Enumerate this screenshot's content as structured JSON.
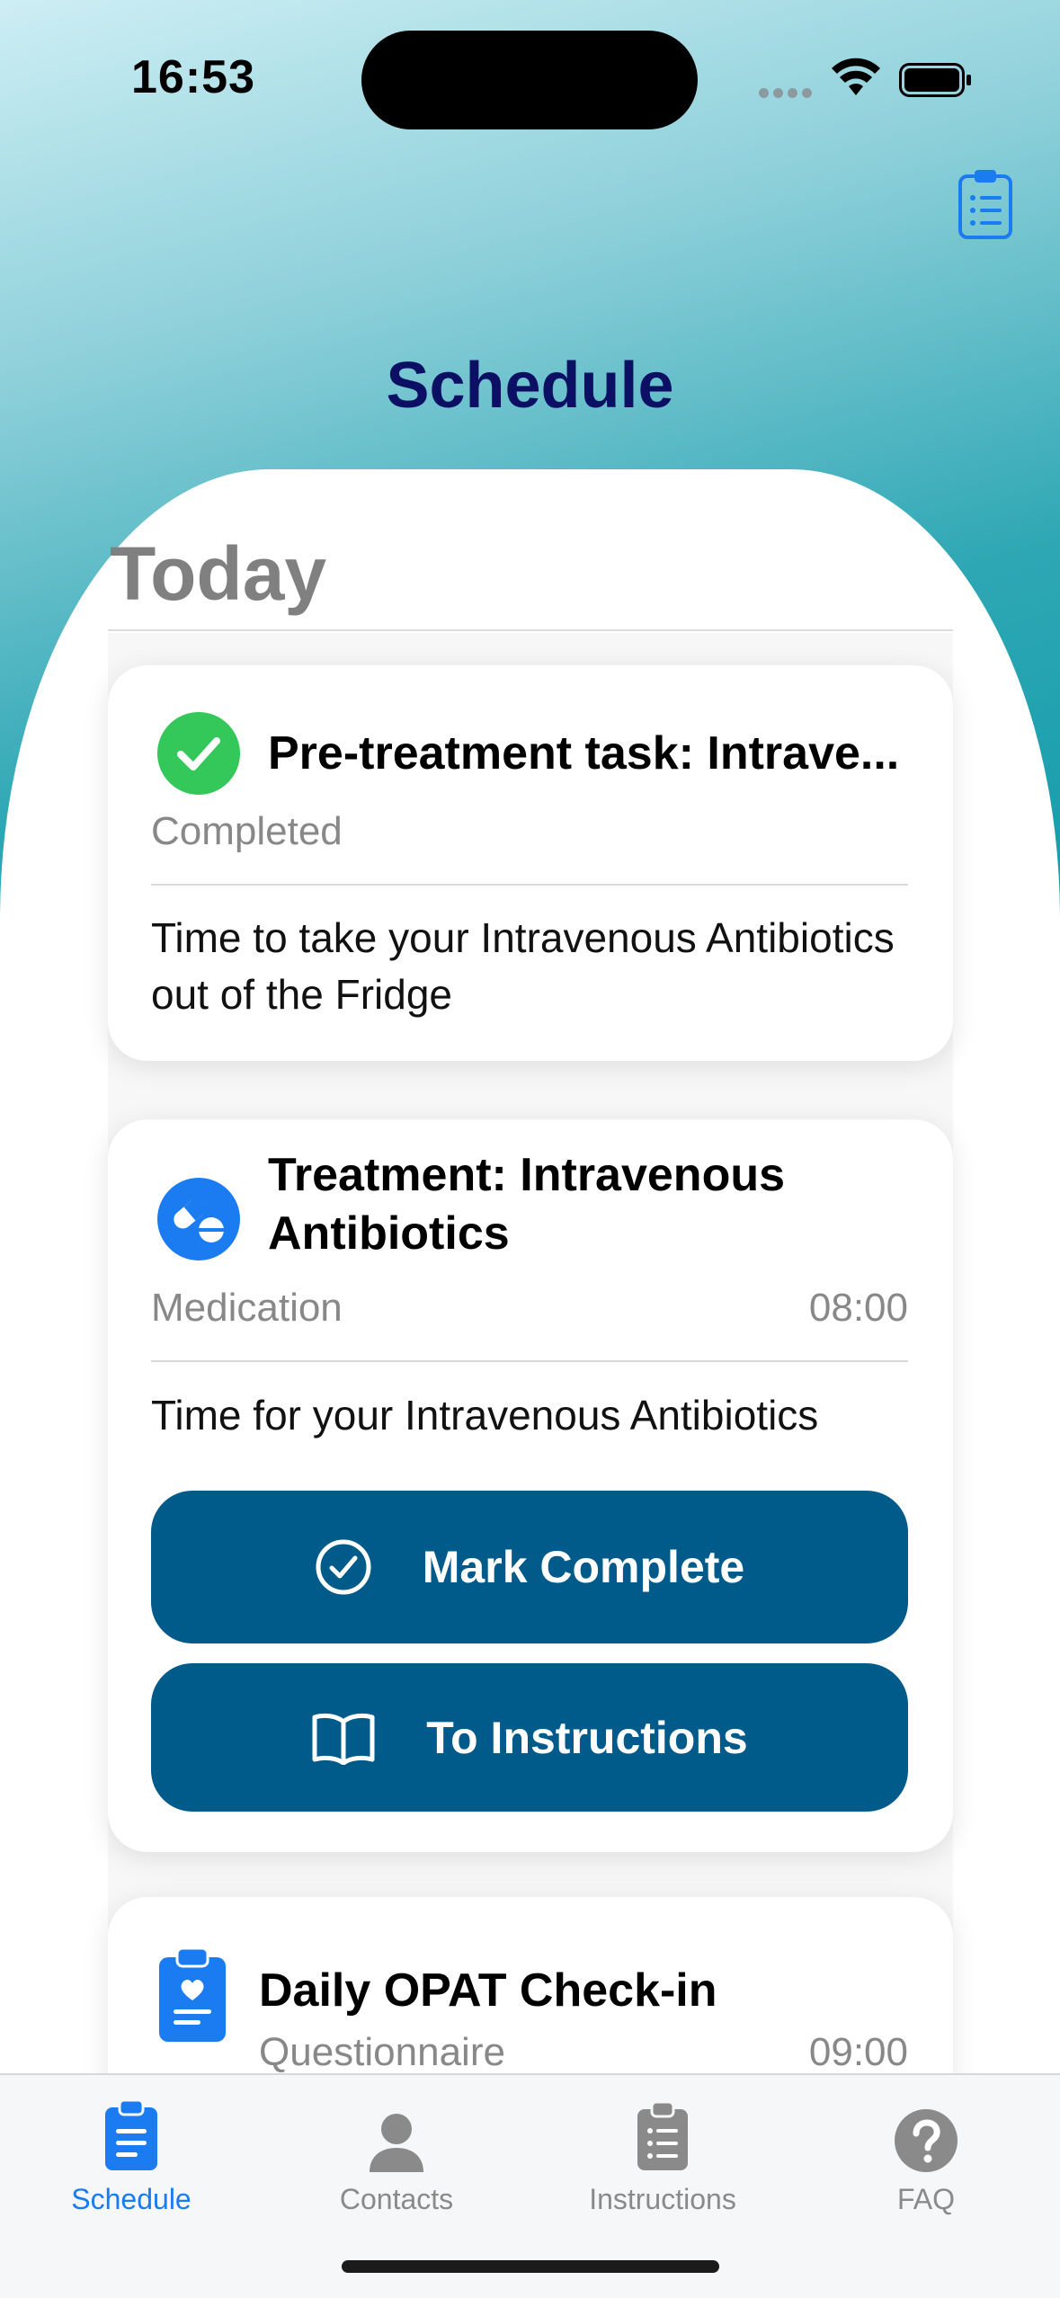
{
  "status_bar": {
    "time": "16:53"
  },
  "header": {
    "title": "Schedule",
    "clipboard_icon": "clipboard-list-icon"
  },
  "section": {
    "title": "Today"
  },
  "cards": [
    {
      "icon": "checkmark-circle-icon",
      "title": "Pre-treatment task: Intrave...",
      "subtitle": "Completed",
      "body": "Time to take your Intravenous Antibiotics out of the Fridge"
    },
    {
      "icon": "pills-icon",
      "title_line1": "Treatment: Intravenous",
      "title_line2": "Antibiotics",
      "subtitle": "Medication",
      "time": "08:00",
      "body": "Time for your Intravenous Antibiotics",
      "buttons": [
        {
          "label": "Mark Complete",
          "icon": "checkmark-circle-outline-icon"
        },
        {
          "label": "To Instructions",
          "icon": "book-icon"
        }
      ]
    },
    {
      "icon": "clipboard-heart-icon",
      "title": "Daily OPAT Check-in",
      "subtitle": "Questionnaire",
      "time": "09:00"
    }
  ],
  "tab_bar": {
    "tabs": [
      {
        "label": "Schedule",
        "icon": "clipboard-icon",
        "active": true
      },
      {
        "label": "Contacts",
        "icon": "person-icon",
        "active": false
      },
      {
        "label": "Instructions",
        "icon": "clipboard-list-icon",
        "active": false
      },
      {
        "label": "FAQ",
        "icon": "question-circle-icon",
        "active": false
      }
    ]
  },
  "colors": {
    "accent": "#1a7cf0",
    "button_bg": "#005a8a",
    "title": "#0b1064",
    "success": "#34c759"
  }
}
